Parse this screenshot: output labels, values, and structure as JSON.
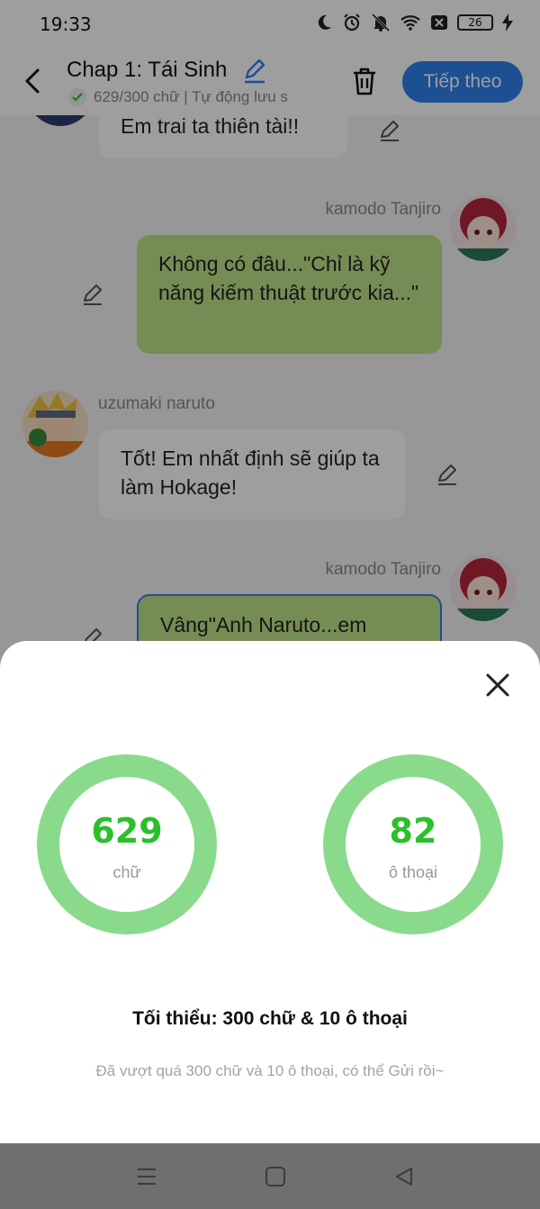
{
  "status": {
    "time": "19:33",
    "battery": "26"
  },
  "appbar": {
    "title": "Chap 1: Tái Sinh",
    "subtitle": "629/300 chữ | Tự động lưu s",
    "next_label": "Tiếp theo"
  },
  "chat": {
    "messages": [
      {
        "side": "left",
        "sender": "",
        "text": "Em trai ta thiên tài!!"
      },
      {
        "side": "right",
        "sender": "kamodo Tanjiro",
        "text": "Không có đâu...\"Chỉ là kỹ năng kiếm thuật trước kia...\""
      },
      {
        "side": "left",
        "sender": "uzumaki naruto",
        "text": "Tốt! Em nhất định sẽ giúp ta làm Hokage!"
      },
      {
        "side": "right",
        "sender": "kamodo Tanjiro",
        "text": "Vâng\"Anh Naruto...em"
      }
    ]
  },
  "stats": {
    "words": {
      "value": "629",
      "unit": "chữ"
    },
    "dialogs": {
      "value": "82",
      "unit": "ô thoại"
    },
    "minimum": "Tối thiểu: 300 chữ & 10 ô thoại",
    "hint": "Đã vượt quá 300 chữ và 10 ô thoại, có thể Gửi rồi~"
  },
  "colors": {
    "accent": "#2f80ed",
    "ring": "#8ada8c",
    "ring_text": "#2cbf2c",
    "bubble_right": "#bfe38a"
  },
  "icons": [
    "moon-icon",
    "alarm-icon",
    "bell-off-icon",
    "wifi-icon",
    "sim-off-icon",
    "battery-icon",
    "charging-icon",
    "back-icon",
    "pencil-icon",
    "check-icon",
    "trash-icon",
    "close-icon",
    "menu-icon",
    "home-icon",
    "back-nav-icon"
  ]
}
